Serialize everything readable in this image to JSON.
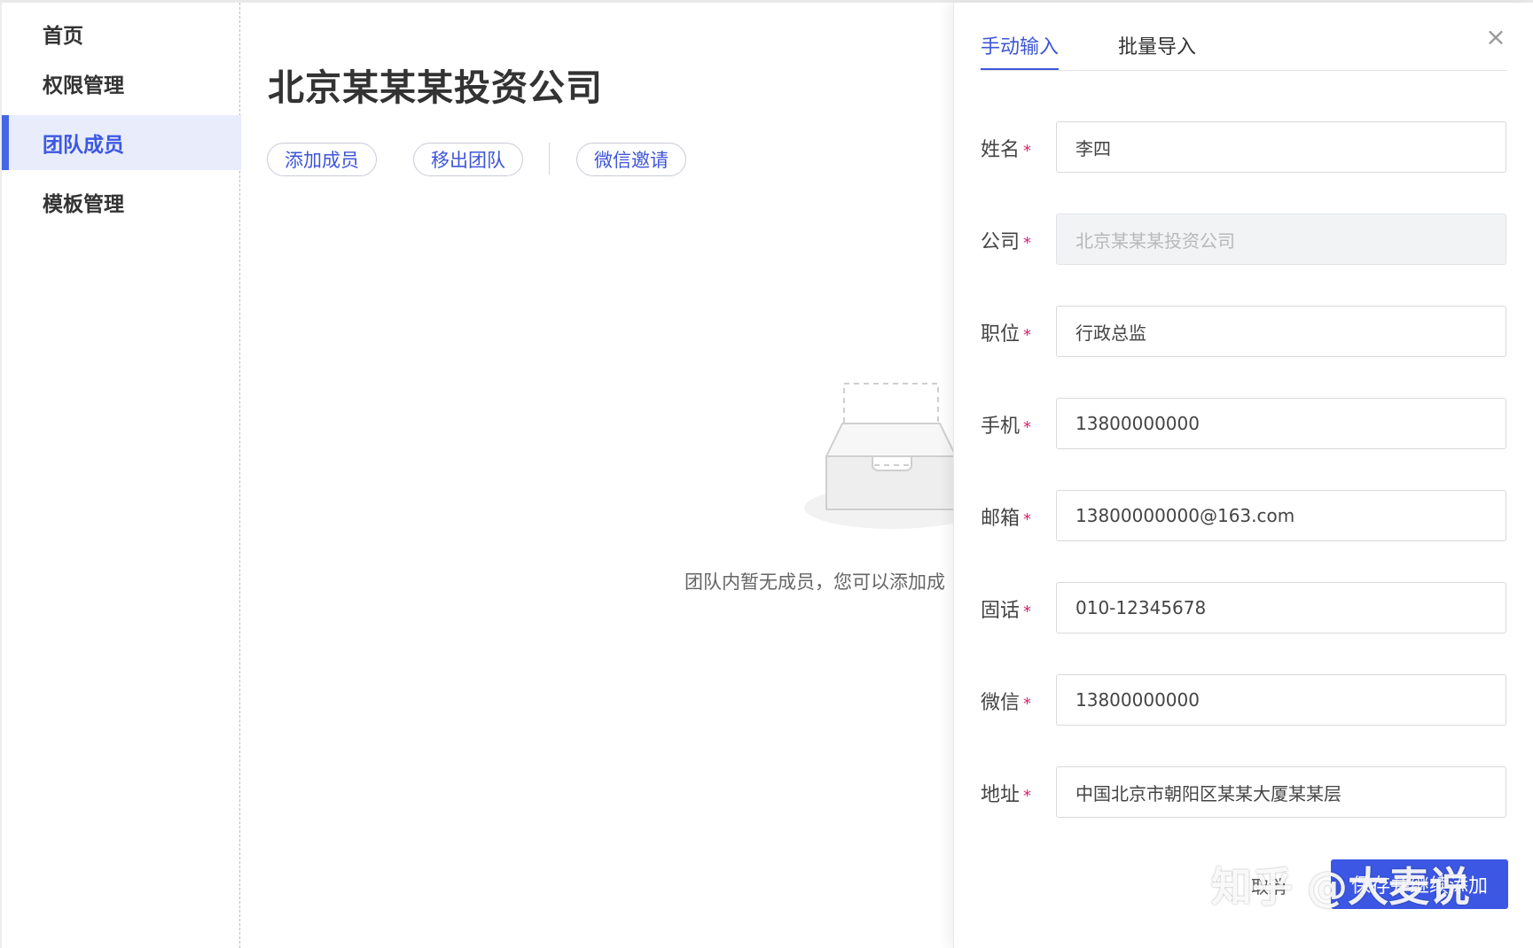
{
  "sidebar": {
    "items": [
      {
        "label": "首页"
      },
      {
        "label": "权限管理"
      },
      {
        "label": "团队成员",
        "active": true
      },
      {
        "label": "模板管理"
      }
    ]
  },
  "main": {
    "company_name": "北京某某某投资公司",
    "actions": {
      "add_member": "添加成员",
      "remove_team": "移出团队",
      "wechat_invite": "微信邀请"
    },
    "empty_text": "团队内暂无成员，您可以添加成"
  },
  "drawer": {
    "tabs": [
      "手动输入",
      "批量导入"
    ],
    "close_icon": "×",
    "fields": [
      {
        "label": "姓名",
        "value": "李四"
      },
      {
        "label": "公司",
        "value": "北京某某某投资公司",
        "disabled": true
      },
      {
        "label": "职位",
        "value": "行政总监"
      },
      {
        "label": "手机",
        "value": "13800000000"
      },
      {
        "label": "邮箱",
        "value": "13800000000@163.com"
      },
      {
        "label": "固话",
        "value": "010-12345678"
      },
      {
        "label": "微信",
        "value": "13800000000"
      },
      {
        "label": "地址",
        "value": "中国北京市朝阳区某某大厦某某层"
      }
    ],
    "required_mark": "*",
    "cancel_label": "取消",
    "save_label": "保存并继续添加"
  },
  "watermark": "知乎 @大麦说",
  "colors": {
    "accent": "#3b57e3",
    "active_bg": "#e9ecfb",
    "required": "#d6246e"
  }
}
